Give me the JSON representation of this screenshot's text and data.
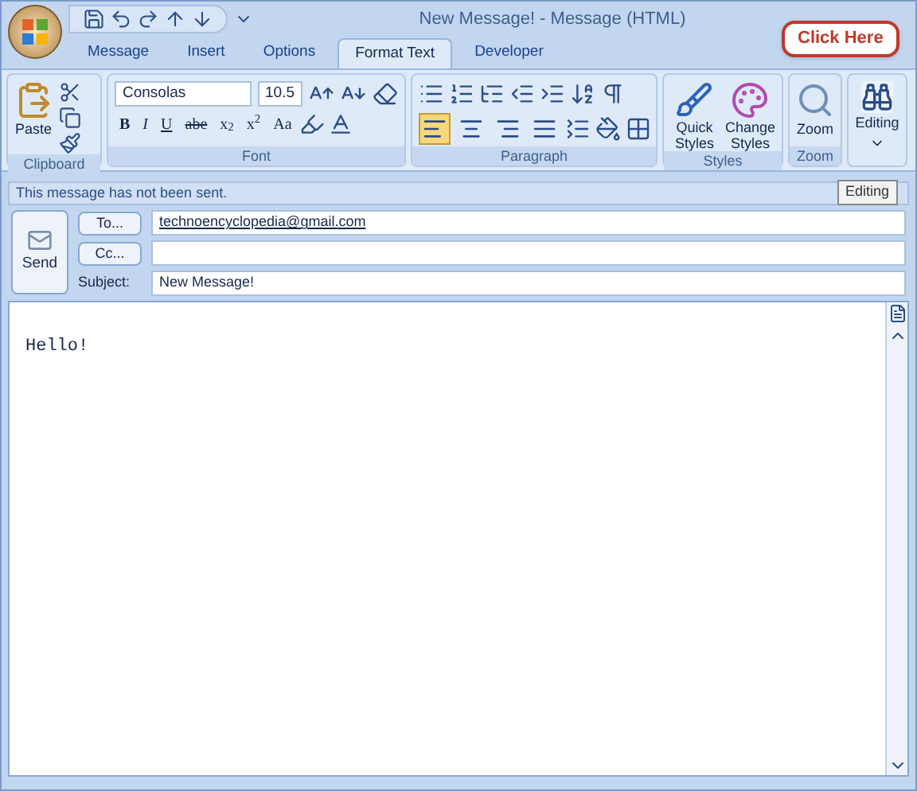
{
  "window": {
    "title": "New Message! - Message (HTML)"
  },
  "tabs": [
    {
      "label": "Message",
      "selected": false
    },
    {
      "label": "Insert",
      "selected": false
    },
    {
      "label": "Options",
      "selected": false
    },
    {
      "label": "Format Text",
      "selected": true
    },
    {
      "label": "Developer",
      "selected": false
    }
  ],
  "ribbon": {
    "clipboard": {
      "label": "Clipboard",
      "paste": "Paste"
    },
    "font": {
      "label": "Font",
      "family": "Consolas",
      "size": "10.5",
      "styles": [
        "B",
        "I",
        "U",
        "abe",
        "x$_{2}$",
        "x$^{2}$",
        "Aa"
      ]
    },
    "paragraph": {
      "label": "Paragraph",
      "alignments": [
        {
          "kind": "left",
          "selected": true
        },
        {
          "kind": "center",
          "selected": false
        },
        {
          "kind": "right",
          "selected": false
        },
        {
          "kind": "justify",
          "selected": false
        }
      ]
    },
    "styles": {
      "label": "Styles",
      "quick": "Quick Styles",
      "change": "Change Styles"
    },
    "zoom": {
      "label": "Zoom",
      "button": "Zoom"
    },
    "editing": {
      "button": "Editing"
    }
  },
  "callout": "Click Here",
  "tooltip": "Editing",
  "info_bar": "This message has not been sent.",
  "header": {
    "send": "Send",
    "to_button": "To...",
    "to": "technoencyclopedia@gmail.com",
    "cc_button": "Cc...",
    "subject_label": "Subject:",
    "subject": "New Message!"
  },
  "body": "Hello!"
}
